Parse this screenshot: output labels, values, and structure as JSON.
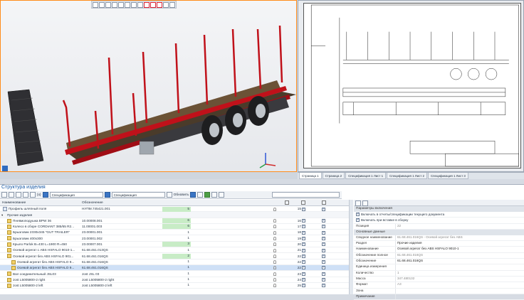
{
  "drawing_tabs": [
    "Страница 1",
    "Страница 2",
    "Спецификация 1 Лист 1",
    "Спецификация 1 Лист 2",
    "Спецификация 1 Лист 3"
  ],
  "structure": {
    "title": "Структура изделия",
    "dropdown_1": "Спецификация",
    "dropdown_2": "Спецификация",
    "update_label": "Обновить",
    "col_name": "Наименование",
    "col_designation": "Обозначение"
  },
  "rows": [
    {
      "name": "Профиль шляпный поля",
      "des": "НУПМ.745421.001",
      "qty": "5",
      "pos": "15",
      "green": true,
      "sel": false
    },
    {
      "name": "Прочие изделия",
      "des": "",
      "qty": "",
      "pos": "",
      "green": false,
      "group": true
    },
    {
      "name": "Пневмоподушка BPW 36",
      "des": "10.00008.001",
      "qty": "6",
      "pos": "16",
      "green": true
    },
    {
      "name": "Колесо в сборе CORDIANT 385/65 R2...",
      "des": "11.00001.003",
      "qty": "6",
      "pos": "17",
      "green": true
    },
    {
      "name": "Брызговик 2330x345 \"GUT TRAILER\"",
      "des": "23.00001.001",
      "qty": "1",
      "pos": "18",
      "green": false
    },
    {
      "name": "Брызговик 400x300",
      "des": "23.00001.002",
      "qty": "1",
      "pos": "19",
      "green": false
    },
    {
      "name": "Крыло Parlok B=430 L=1900 R=450",
      "des": "23.00007.001",
      "qty": "3",
      "pos": "20",
      "green": true
    },
    {
      "name": "Осевой агрегат с ABS HSFALO 9010-1...",
      "des": "61.68.461.013QS",
      "qty": "1",
      "pos": "21",
      "green": false
    },
    {
      "name": "Осевой агрегат без ABS HSFALO 901...",
      "des": "61.68.461.016QS",
      "qty": "2",
      "pos": "22",
      "green": true
    },
    {
      "name": "Осевой агрегат без ABS HSFALO 9...",
      "des": "61.68.461.016QS",
      "qty": "1",
      "pos": "22",
      "green": false
    },
    {
      "name": "Осевой агрегат без ABS HSFALO 9...",
      "des": "61.68.461.016QS",
      "qty": "1",
      "pos": "22",
      "green": false,
      "sel": true
    },
    {
      "name": "Вал соединительный JSL03",
      "des": "Jost JSL 03",
      "qty": "1",
      "pos": "23",
      "green": false
    },
    {
      "name": "Jost L5005800-2 right",
      "des": "Jost L5005800-2 right",
      "qty": "1",
      "pos": "24",
      "green": false
    },
    {
      "name": "Jost L5005800-2 left",
      "des": "Jost L5005800-2 left",
      "qty": "1",
      "pos": "25",
      "green": false
    }
  ],
  "properties": {
    "section_inclusion": "Параметры включения",
    "check_1": "Включать в отчеты/спецификации текущего документа",
    "check_2": "Включать при вставке в сборку",
    "pos_label": "Позиция",
    "pos_value": "22",
    "section_main": "Основные данные",
    "rows": [
      {
        "k": "Сводное наименование",
        "v": "61.68.461.016QS - Осевой агрегат без ABS",
        "dim": true
      },
      {
        "k": "Раздел",
        "v": "Прочие изделия",
        "dim": false
      },
      {
        "k": "Наименование",
        "v": "Осевой агрегат без ABS HSFALO 9010-1",
        "dim": false
      },
      {
        "k": "Обозначение полное",
        "v": "61.68.461.016QS",
        "dim": true
      },
      {
        "k": "Обозначение",
        "v": "61.68.461.016QS",
        "dim": false
      },
      {
        "k": "Единица измерения",
        "v": "",
        "dim": true
      },
      {
        "k": "Количество",
        "v": "1",
        "dim": true
      },
      {
        "k": "Масса",
        "v": "347.480132",
        "dim": true
      },
      {
        "k": "Формат",
        "v": "А3",
        "dim": true
      },
      {
        "k": "Зона",
        "v": "",
        "dim": true
      },
      {
        "k": "Примечание",
        "v": "",
        "dim": true
      }
    ]
  },
  "colors": {
    "accent": "#1a5aa6",
    "frame": "#c0111a",
    "highlight": "#ff8c1a"
  }
}
